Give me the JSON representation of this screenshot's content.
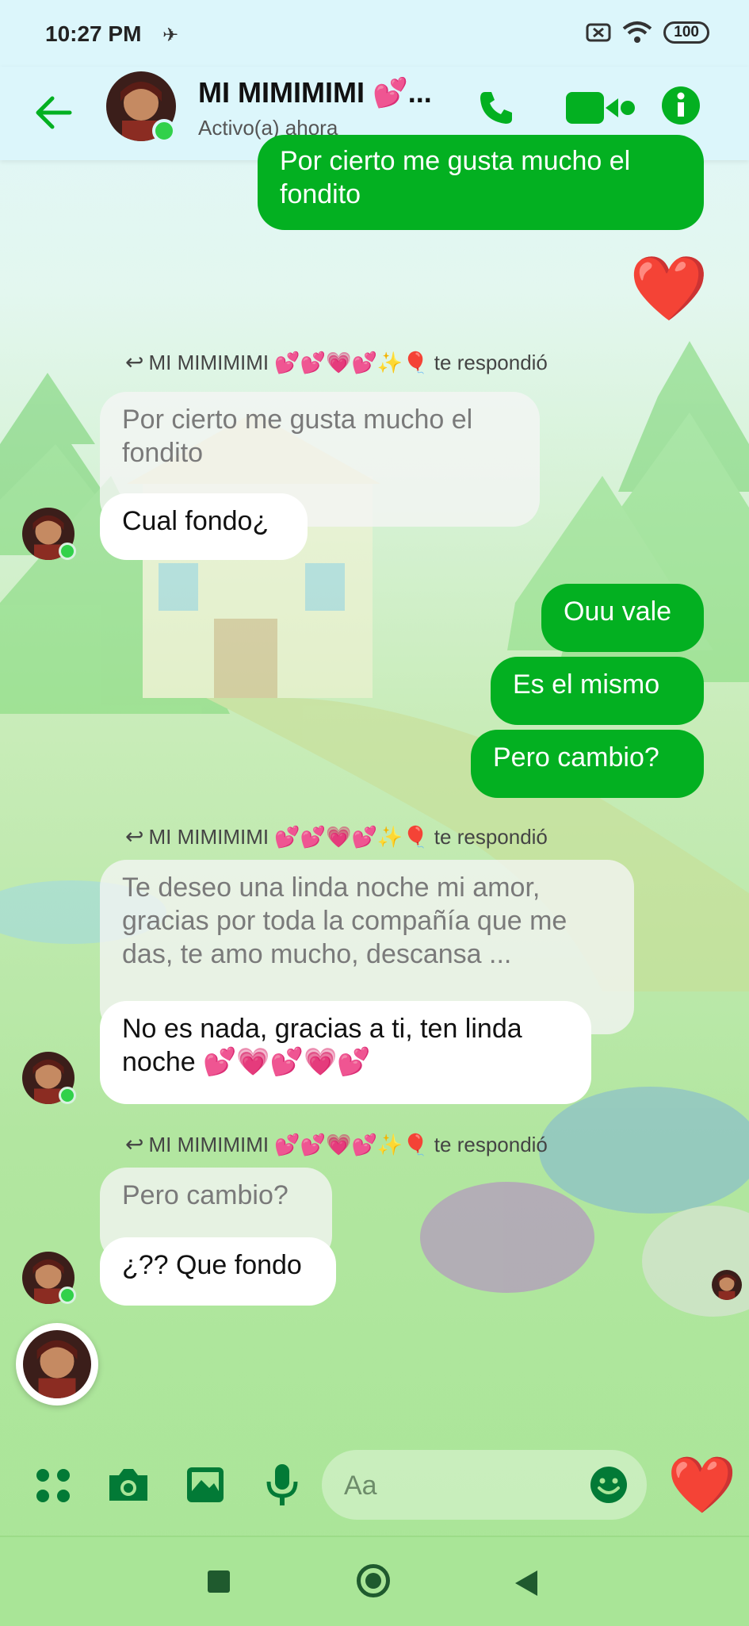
{
  "status_bar": {
    "time": "10:27 PM",
    "battery": "100"
  },
  "header": {
    "contact_name": "MI MIMIMIMI 💕...",
    "contact_status": "Activo(a) ahora"
  },
  "colors": {
    "accent": "#03b021",
    "incoming_bg": "#ffffff"
  },
  "messages": {
    "out_top": "Por cierto me gusta mucho el fondito",
    "heart": "❤️",
    "reply1": {
      "label": "MI MIMIMIMI 💕💕💗💕✨🎈 te respondió",
      "quoted": "Por cierto me gusta mucho el fondito",
      "text": "Cual fondo¿"
    },
    "out1": "Ouu vale",
    "out2": "Es el mismo",
    "out3": "Pero cambio?",
    "reply2": {
      "label": "MI MIMIMIMI 💕💕💗💕✨🎈 te respondió",
      "quoted": "Te deseo una linda noche mi amor, gracias por toda la compañía que me das, te amo mucho, descansa ...",
      "text": "No es nada, gracias a ti, ten linda noche 💕💗💕💗💕"
    },
    "reply3": {
      "label": "MI MIMIMIMI 💕💕💗💕✨🎈 te respondió",
      "quoted": "Pero cambio?",
      "text": "¿?? Que fondo"
    }
  },
  "composer": {
    "placeholder": "Aa",
    "like": "❤️"
  },
  "icons": [
    "back-arrow-icon",
    "phone-icon",
    "video-icon",
    "info-icon",
    "apps-icon",
    "camera-icon",
    "gallery-icon",
    "mic-icon",
    "emoji-icon"
  ]
}
